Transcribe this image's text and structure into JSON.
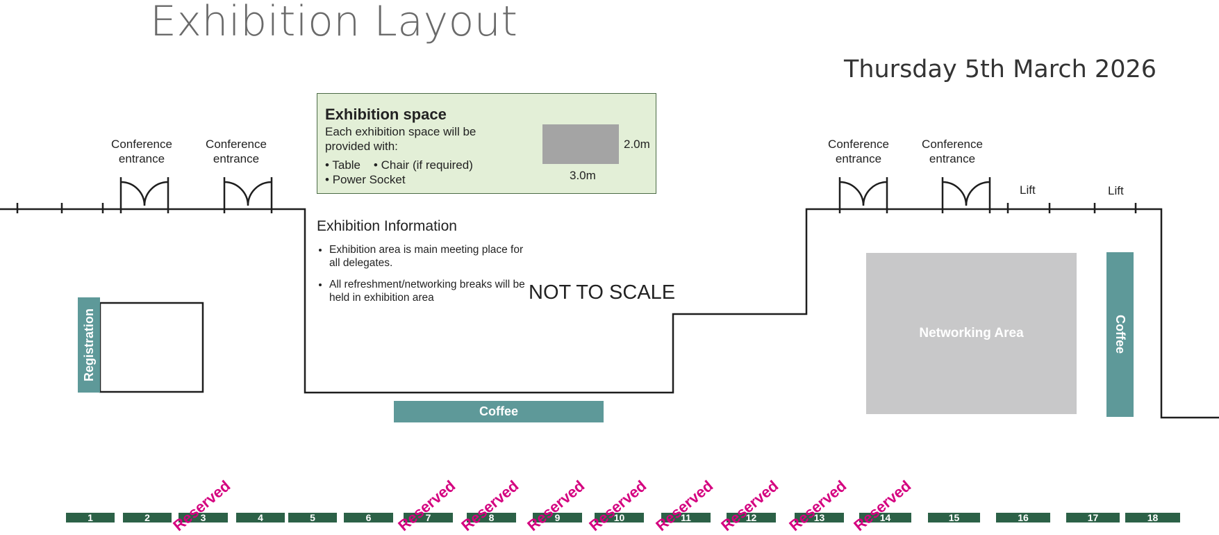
{
  "title": "Exhibition Layout",
  "date": "Thursday 5th March 2026",
  "entrance_label": "Conference\nentrance",
  "lift_label": "Lift",
  "exhibition_space": {
    "heading": "Exhibition space",
    "description": "Each exhibition space will be provided with:",
    "items": [
      "Table",
      "Chair (if required)",
      "Power Socket"
    ],
    "width_label": "3.0m",
    "depth_label": "2.0m"
  },
  "exhibition_info": {
    "heading": "Exhibition Information",
    "points": [
      "Exhibition area is main meeting place for all delegates.",
      "All refreshment/networking breaks will be held in exhibition area"
    ]
  },
  "scale_note": "NOT TO SCALE",
  "areas": {
    "registration": "Registration",
    "coffee_bottom": "Coffee",
    "coffee_right": "Coffee",
    "networking": "Networking Area"
  },
  "stands": [
    {
      "number": "1",
      "reserved": false
    },
    {
      "number": "2",
      "reserved": false
    },
    {
      "number": "3",
      "reserved": true
    },
    {
      "number": "4",
      "reserved": false
    },
    {
      "number": "5",
      "reserved": false
    },
    {
      "number": "6",
      "reserved": false
    },
    {
      "number": "7",
      "reserved": true
    },
    {
      "number": "8",
      "reserved": true
    },
    {
      "number": "9",
      "reserved": true
    },
    {
      "number": "10",
      "reserved": true
    },
    {
      "number": "11",
      "reserved": true
    },
    {
      "number": "12",
      "reserved": true
    },
    {
      "number": "13",
      "reserved": true
    },
    {
      "number": "14",
      "reserved": true
    },
    {
      "number": "15",
      "reserved": false
    },
    {
      "number": "16",
      "reserved": false
    },
    {
      "number": "17",
      "reserved": false
    },
    {
      "number": "18",
      "reserved": false
    }
  ],
  "reserved_label": "Reserved",
  "colors": {
    "title_grey": "#6a6a6a",
    "info_box": "#e3efd7",
    "teal": "#5e9999",
    "stand_green": "#2c6147",
    "networking_grey": "#c8c8c9",
    "reserved_magenta": "#d4007f"
  }
}
